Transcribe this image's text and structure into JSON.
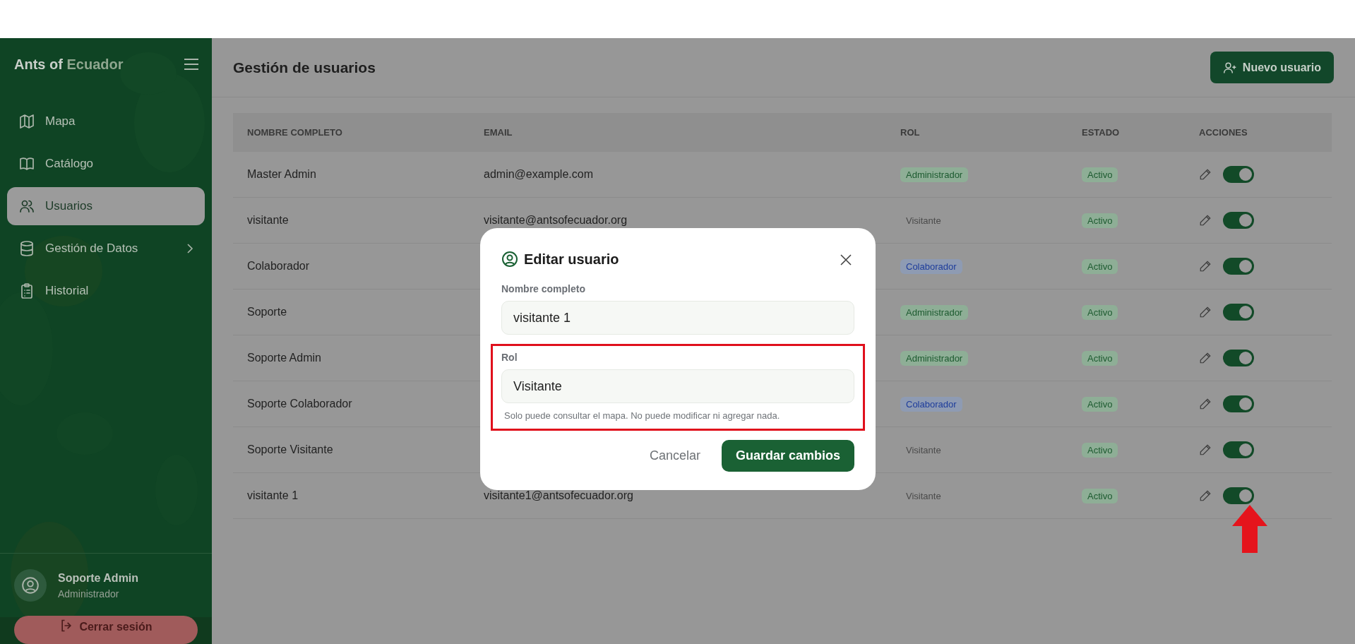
{
  "sidebar": {
    "brand_primary": "Ants of",
    "brand_accent": "Ecuador",
    "items": [
      {
        "label": "Mapa",
        "selected": false,
        "has_submenu": false
      },
      {
        "label": "Catálogo",
        "selected": false,
        "has_submenu": false
      },
      {
        "label": "Usuarios",
        "selected": true,
        "has_submenu": false
      },
      {
        "label": "Gestión de Datos",
        "selected": false,
        "has_submenu": true
      },
      {
        "label": "Historial",
        "selected": false,
        "has_submenu": false
      }
    ],
    "user": {
      "name": "Soporte Admin",
      "role": "Administrador"
    },
    "logout": "Cerrar sesión"
  },
  "header": {
    "title": "Gestión de usuarios",
    "new_button": "Nuevo usuario"
  },
  "table": {
    "columns": [
      "NOMBRE COMPLETO",
      "EMAIL",
      "ROL",
      "ESTADO",
      "ACCIONES"
    ],
    "rows": [
      {
        "name": "Master Admin",
        "email": "admin@example.com",
        "role": "Administrador",
        "kind": "admin",
        "status": "Activo",
        "active": true
      },
      {
        "name": "visitante",
        "email": "visitante@antsofecuador.org",
        "role": "Visitante",
        "kind": "visitor",
        "status": "Activo",
        "active": true
      },
      {
        "name": "Colaborador",
        "role": "Colaborador",
        "kind": "collaborator",
        "status": "Activo",
        "active": true
      },
      {
        "name": "Soporte",
        "role": "Administrador",
        "kind": "admin",
        "status": "Activo",
        "active": true
      },
      {
        "name": "Soporte Admin",
        "role": "Administrador",
        "kind": "admin",
        "status": "Activo",
        "active": true
      },
      {
        "name": "Soporte Colaborador",
        "role": "Colaborador",
        "kind": "collaborator",
        "status": "Activo",
        "active": true
      },
      {
        "name": "Soporte Visitante",
        "role": "Visitante",
        "kind": "visitor",
        "status": "Activo",
        "active": true
      },
      {
        "name": "visitante 1",
        "email": "visitante1@antsofecuador.org",
        "role": "Visitante",
        "kind": "visitor",
        "status": "Activo",
        "active": true
      }
    ]
  },
  "modal": {
    "title": "Editar usuario",
    "fields": [
      {
        "label": "Nombre completo",
        "value": "visitante 1",
        "highlighted": false
      },
      {
        "label": "Rol",
        "value": "Visitante",
        "hint": "Solo puede consultar el mapa. No puede modificar ni agregar nada.",
        "highlighted": true
      }
    ],
    "cancel": "Cancelar",
    "save": "Guardar cambios"
  }
}
